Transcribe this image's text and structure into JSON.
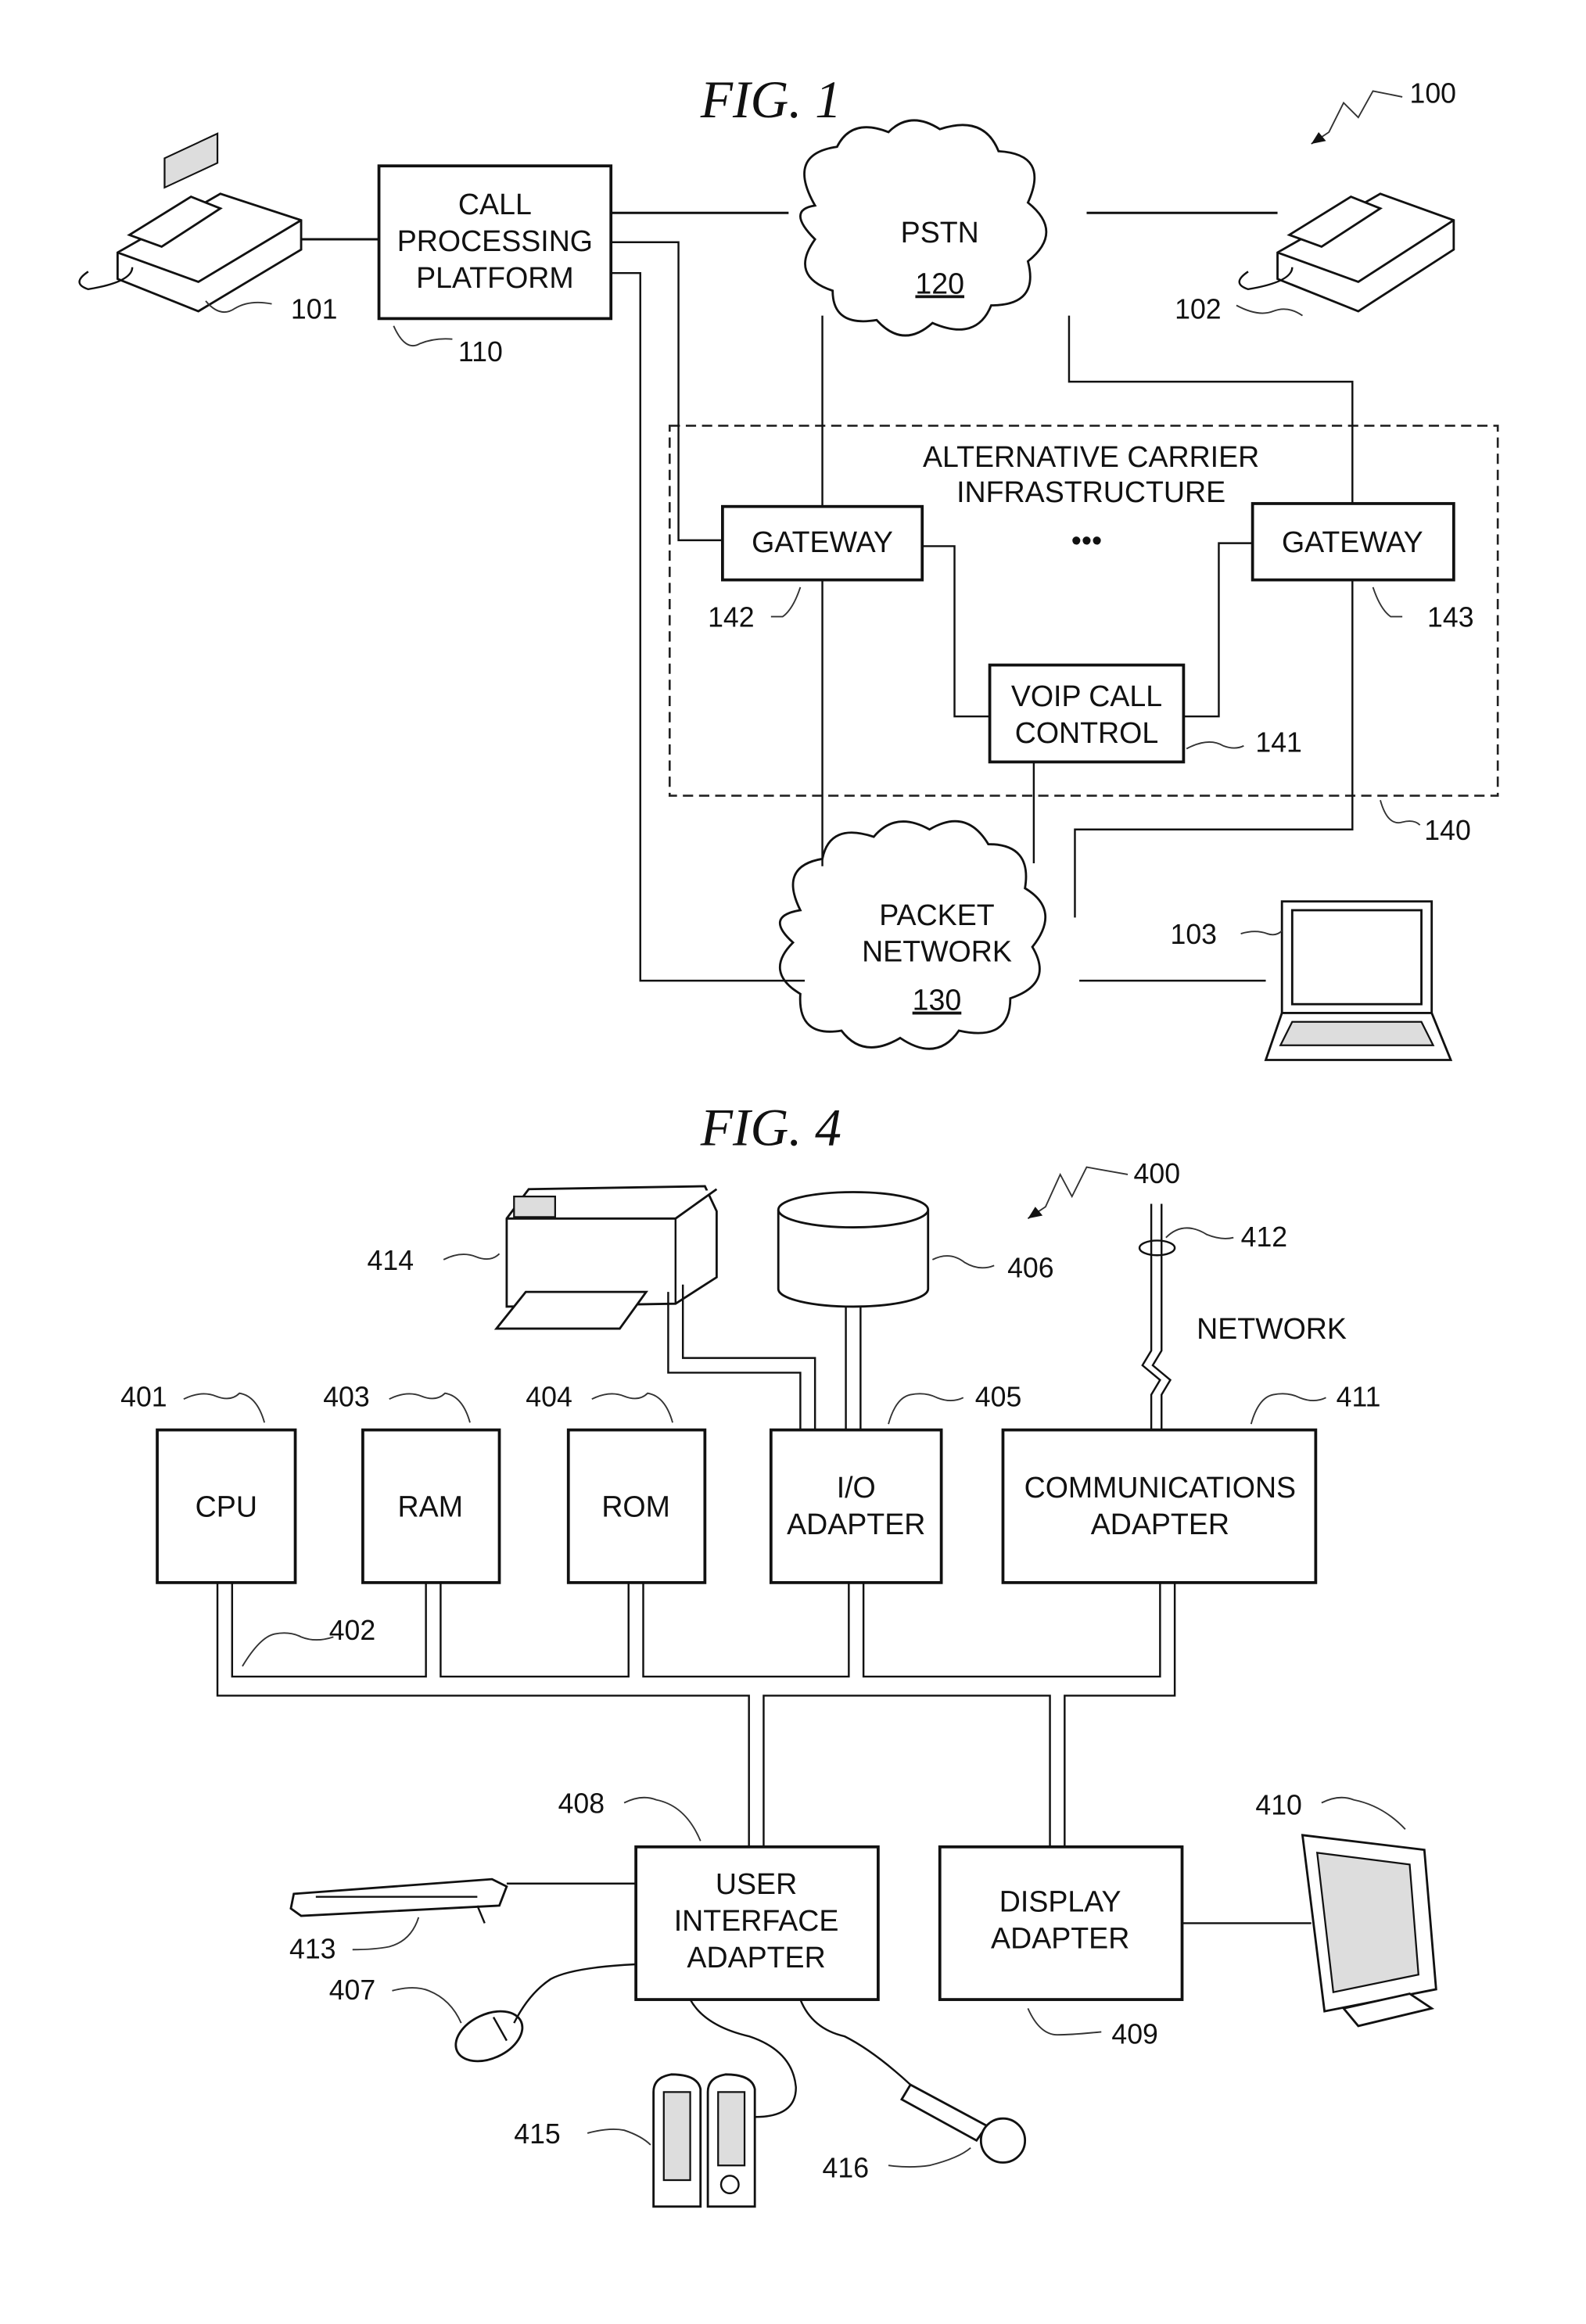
{
  "fig1": {
    "title": "FIG. 1",
    "system_ref": "100",
    "phone_left_ref": "101",
    "phone_right_ref": "102",
    "laptop_ref": "103",
    "call_platform": {
      "lines": [
        "CALL",
        "PROCESSING",
        "PLATFORM"
      ],
      "ref": "110"
    },
    "pstn": {
      "label": "PSTN",
      "ref": "120"
    },
    "packet_network": {
      "lines": [
        "PACKET",
        "NETWORK"
      ],
      "ref": "130"
    },
    "alt_carrier": {
      "lines": [
        "ALTERNATIVE CARRIER",
        "INFRASTRUCTURE"
      ],
      "ref": "140",
      "ellipsis": "•••"
    },
    "gateway_left": {
      "label": "GATEWAY",
      "ref": "142"
    },
    "gateway_right": {
      "label": "GATEWAY",
      "ref": "143"
    },
    "voip": {
      "lines": [
        "VOIP CALL",
        "CONTROL"
      ],
      "ref": "141"
    }
  },
  "fig4": {
    "title": "FIG. 4",
    "system_ref": "400",
    "cpu": {
      "label": "CPU",
      "ref": "401"
    },
    "bus_ref": "402",
    "ram": {
      "label": "RAM",
      "ref": "403"
    },
    "rom": {
      "label": "ROM",
      "ref": "404"
    },
    "io_adapter": {
      "lines": [
        "I/O",
        "ADAPTER"
      ],
      "ref": "405"
    },
    "disk_ref": "406",
    "mouse_ref": "407",
    "ui_adapter": {
      "lines": [
        "USER",
        "INTERFACE",
        "ADAPTER"
      ],
      "ref": "408"
    },
    "display_adapter": {
      "lines": [
        "DISPLAY",
        "ADAPTER"
      ],
      "ref": "409"
    },
    "monitor_ref": "410",
    "comm_adapter": {
      "lines": [
        "COMMUNICATIONS",
        "ADAPTER"
      ],
      "ref": "411"
    },
    "network": {
      "label": "NETWORK",
      "ref": "412"
    },
    "keyboard_ref": "413",
    "printer_ref": "414",
    "speakers_ref": "415",
    "microphone_ref": "416"
  }
}
